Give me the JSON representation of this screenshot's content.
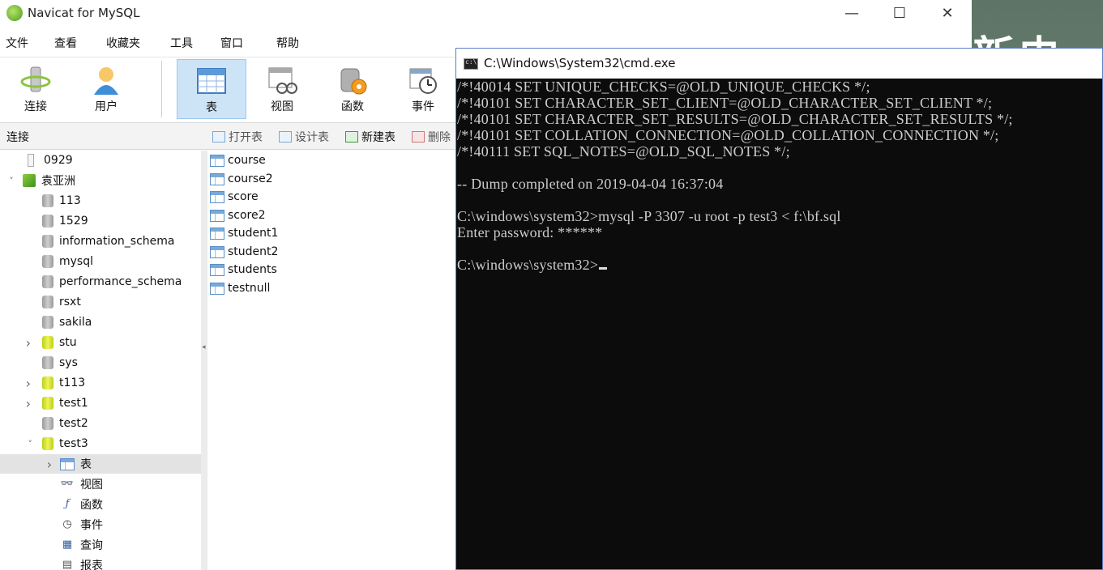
{
  "navicat": {
    "title": "Navicat for MySQL",
    "window_controls": {
      "minimize": "—",
      "maximize": "☐",
      "close": "✕"
    },
    "menu": [
      "文件",
      "查看",
      "收藏夹",
      "工具",
      "窗口",
      "帮助"
    ],
    "toolbar": [
      {
        "label": "连接",
        "icon": "connection-icon",
        "active": false
      },
      {
        "label": "用户",
        "icon": "user-icon",
        "active": false
      },
      {
        "label": "表",
        "icon": "table-icon",
        "active": true
      },
      {
        "label": "视图",
        "icon": "view-icon",
        "active": false
      },
      {
        "label": "函数",
        "icon": "function-icon",
        "active": false
      },
      {
        "label": "事件",
        "icon": "event-icon",
        "active": false
      }
    ],
    "subbar": {
      "title": "连接",
      "open_table": "打开表",
      "design_table": "设计表",
      "new_table": "新建表",
      "delete": "删除"
    },
    "tree": [
      {
        "label": "0929",
        "kind": "plain",
        "expander": ""
      },
      {
        "label": "袁亚洲",
        "kind": "connection",
        "expander": "˅"
      },
      {
        "label": "113",
        "kind": "db-gray",
        "expander": ""
      },
      {
        "label": "1529",
        "kind": "db-gray",
        "expander": ""
      },
      {
        "label": "information_schema",
        "kind": "db-gray",
        "expander": ""
      },
      {
        "label": "mysql",
        "kind": "db-gray",
        "expander": ""
      },
      {
        "label": "performance_schema",
        "kind": "db-gray",
        "expander": ""
      },
      {
        "label": "rsxt",
        "kind": "db-gray",
        "expander": ""
      },
      {
        "label": "sakila",
        "kind": "db-gray",
        "expander": ""
      },
      {
        "label": "stu",
        "kind": "db-green",
        "expander": "›"
      },
      {
        "label": "sys",
        "kind": "db-gray",
        "expander": ""
      },
      {
        "label": "t113",
        "kind": "db-green",
        "expander": "›"
      },
      {
        "label": "test1",
        "kind": "db-green",
        "expander": "›"
      },
      {
        "label": "test2",
        "kind": "db-gray",
        "expander": ""
      },
      {
        "label": "test3",
        "kind": "db-green",
        "expander": "˅"
      },
      {
        "label": "表",
        "kind": "tables",
        "expander": "›"
      },
      {
        "label": "视图",
        "kind": "views",
        "expander": ""
      },
      {
        "label": "函数",
        "kind": "functions",
        "expander": ""
      },
      {
        "label": "事件",
        "kind": "events",
        "expander": ""
      },
      {
        "label": "查询",
        "kind": "queries",
        "expander": ""
      },
      {
        "label": "报表",
        "kind": "reports",
        "expander": ""
      }
    ],
    "selected_tree_item": "表",
    "tables": [
      "course",
      "course2",
      "score",
      "score2",
      "student1",
      "student2",
      "students",
      "testnull"
    ]
  },
  "cmd": {
    "title": "C:\\Windows\\System32\\cmd.exe",
    "lines": [
      "/*!40014 SET UNIQUE_CHECKS=@OLD_UNIQUE_CHECKS */;",
      "/*!40101 SET CHARACTER_SET_CLIENT=@OLD_CHARACTER_SET_CLIENT */;",
      "/*!40101 SET CHARACTER_SET_RESULTS=@OLD_CHARACTER_SET_RESULTS */;",
      "/*!40101 SET COLLATION_CONNECTION=@OLD_COLLATION_CONNECTION */;",
      "/*!40111 SET SQL_NOTES=@OLD_SQL_NOTES */;",
      "",
      "-- Dump completed on 2019-04-04 16:37:04",
      "",
      "C:\\windows\\system32>mysql -P 3307 -u root -p test3 < f:\\bf.sql",
      "Enter password: ******",
      "",
      "C:\\windows\\system32>"
    ]
  },
  "desktop": {
    "text": "新史"
  }
}
